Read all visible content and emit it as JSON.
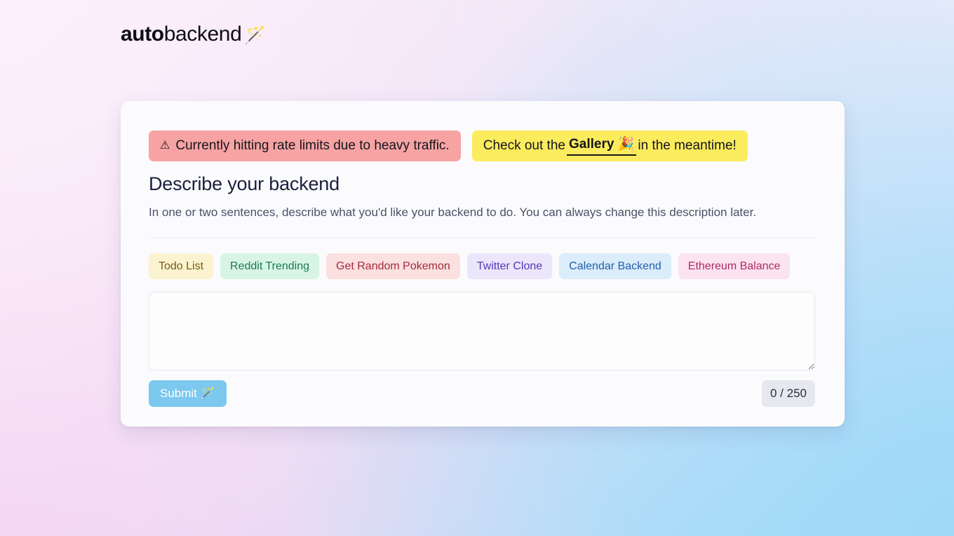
{
  "logo": {
    "word_bold": "auto",
    "word_regular": "backend",
    "wand_icon": "🪄"
  },
  "banners": {
    "rate_limit": {
      "icon": "⚠",
      "text": "Currently hitting rate limits due to heavy traffic."
    },
    "gallery": {
      "prefix": "Check out the",
      "link": "Gallery 🎉",
      "suffix": "in the meantime!"
    }
  },
  "form": {
    "title": "Describe your backend",
    "subtitle": "In one or two sentences, describe what you'd like your backend to do. You can always change this description later.",
    "textarea_value": "",
    "textarea_placeholder": "",
    "submit_label": "Submit",
    "submit_wand": "🪄",
    "counter": "0 / 250"
  },
  "examples": [
    {
      "label": "Todo List",
      "bg": "#fbf3d0",
      "fg": "#7a5c12"
    },
    {
      "label": "Reddit Trending",
      "bg": "#d8f5e4",
      "fg": "#1d7a4e"
    },
    {
      "label": "Get Random Pokemon",
      "bg": "#fbe0e0",
      "fg": "#a32a3c"
    },
    {
      "label": "Twitter Clone",
      "bg": "#ebe6fb",
      "fg": "#5238b8"
    },
    {
      "label": "Calendar Backend",
      "bg": "#dbecfb",
      "fg": "#1f5fa8"
    },
    {
      "label": "Ethereum Balance",
      "bg": "#fbe3ef",
      "fg": "#b02a63"
    }
  ]
}
